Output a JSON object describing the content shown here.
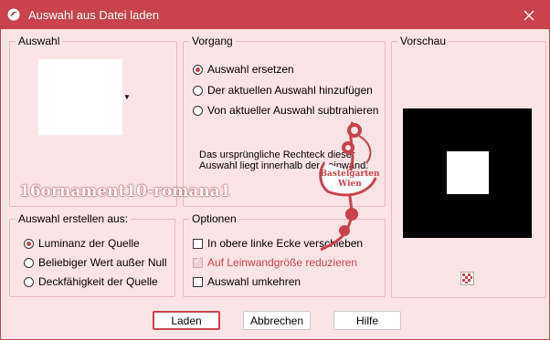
{
  "window": {
    "title": "Auswahl aus Datei laden"
  },
  "auswahl": {
    "label": "Auswahl"
  },
  "vorgang": {
    "label": "Vorgang",
    "options": [
      "Auswahl ersetzen",
      "Der aktuellen Auswahl hinzufügen",
      "Von aktueller Auswahl subtrahieren"
    ],
    "description": "Das ursprüngliche Rechteck dieser Auswahl liegt innerhalb der Leinwand."
  },
  "vorschau": {
    "label": "Vorschau"
  },
  "erstellen": {
    "label": "Auswahl erstellen aus:",
    "options": [
      "Luminanz der Quelle",
      "Beliebiger Wert außer Null",
      "Deckfähigkeit der Quelle"
    ]
  },
  "optionen": {
    "label": "Optionen",
    "items": [
      "In obere linke Ecke verschieben",
      "Auf Leinwandgröße reduzieren",
      "Auswahl umkehren"
    ]
  },
  "buttons": {
    "laden": "Laden",
    "abbrechen": "Abbrechen",
    "hilfe": "Hilfe"
  },
  "watermark": "16ornament10-romana1",
  "stamp": {
    "line1": "Bastelgarten",
    "line2": "Wien"
  },
  "colors": {
    "accent": "#c9434c",
    "background": "#fce4e6"
  }
}
